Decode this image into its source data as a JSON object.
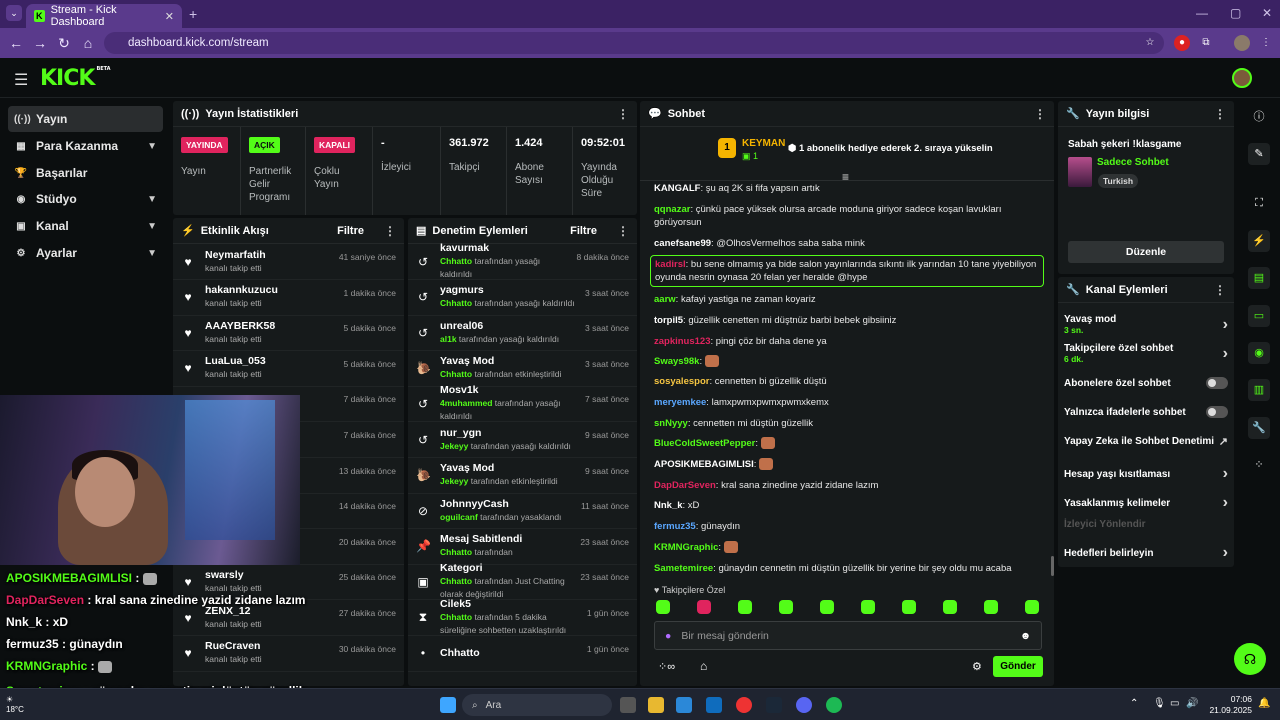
{
  "browser": {
    "tab_title": "Stream - Kick Dashboard",
    "url": "dashboard.kick.com/stream"
  },
  "kick": {
    "logo": "KICK",
    "logo_sup": "BETA"
  },
  "sidebar": {
    "items": [
      {
        "label": "Yayın",
        "icon": "broadcast-icon"
      },
      {
        "label": "Para Kazanma",
        "icon": "money-icon"
      },
      {
        "label": "Başarılar",
        "icon": "trophy-icon"
      },
      {
        "label": "Stüdyo",
        "icon": "studio-icon"
      },
      {
        "label": "Kanal",
        "icon": "channel-icon"
      },
      {
        "label": "Ayarlar",
        "icon": "gear-icon"
      }
    ]
  },
  "stats": {
    "title": "Yayın İstatistikleri",
    "cols": [
      {
        "badge": "YAYINDA",
        "label": "Yayın"
      },
      {
        "badge": "AÇIK",
        "label": "Partnerlik Gelir Programı"
      },
      {
        "badge": "KAPALI",
        "label": "Çoklu Yayın"
      },
      {
        "value": "-",
        "label": "İzleyici"
      },
      {
        "value": "361.972",
        "label": "Takipçi"
      },
      {
        "value": "1.424",
        "label": "Abone Sayısı"
      },
      {
        "value": "09:52:01",
        "label": "Yayında Olduğu Süre"
      }
    ]
  },
  "activity": {
    "title": "Etkinlik Akışı",
    "filter": "Filtre",
    "rows": [
      {
        "name": "Neymarfatih",
        "desc": "kanalı takip etti",
        "time": "41 saniye önce"
      },
      {
        "name": "hakannkuzucu",
        "desc": "kanalı takip etti",
        "time": "1 dakika önce"
      },
      {
        "name": "AAAYBERK58",
        "desc": "kanalı takip etti",
        "time": "5 dakika önce"
      },
      {
        "name": "LuaLua_053",
        "desc": "kanalı takip etti",
        "time": "5 dakika önce"
      },
      {
        "name": "",
        "desc": "",
        "time": "7 dakika önce"
      },
      {
        "name": "",
        "desc": "",
        "time": "7 dakika önce"
      },
      {
        "name": "",
        "desc": "",
        "time": "13 dakika önce"
      },
      {
        "name": "",
        "desc": "",
        "time": "14 dakika önce"
      },
      {
        "name": "",
        "desc": "",
        "time": "20 dakika önce"
      },
      {
        "name": "swarsly",
        "desc": "kanalı takip etti",
        "time": "25 dakika önce"
      },
      {
        "name": "ZENX_12",
        "desc": "kanalı takip etti",
        "time": "27 dakika önce"
      },
      {
        "name": "RueCraven",
        "desc": "kanalı takip etti",
        "time": "30 dakika önce"
      }
    ]
  },
  "moderation": {
    "title": "Denetim Eylemleri",
    "filter": "Filtre",
    "rows": [
      {
        "name": "kavurmak",
        "who": "Chhatto",
        "desc": "tarafından yasağı kaldırıldı",
        "time": "8 dakika önce",
        "icon": "undo-icon"
      },
      {
        "name": "yagmurs",
        "who": "Chhatto",
        "desc": "tarafından yasağı kaldırıldı",
        "time": "3 saat önce",
        "icon": "undo-icon"
      },
      {
        "name": "unreal06",
        "who": "al1k",
        "desc": "tarafından yasağı kaldırıldı",
        "time": "3 saat önce",
        "icon": "undo-icon"
      },
      {
        "name": "Yavaş Mod",
        "who": "Chhatto",
        "desc": "tarafından etkinleştirildi",
        "time": "3 saat önce",
        "icon": "snail-icon"
      },
      {
        "name": "Mosv1k",
        "who": "4muhammed",
        "desc": "tarafından yasağı kaldırıldı",
        "time": "7 saat önce",
        "icon": "undo-icon"
      },
      {
        "name": "nur_ygn",
        "who": "Jekeyy",
        "desc": "tarafından yasağı kaldırıldı",
        "time": "9 saat önce",
        "icon": "undo-icon"
      },
      {
        "name": "Yavaş Mod",
        "who": "Jekeyy",
        "desc": "tarafından etkinleştirildi",
        "time": "9 saat önce",
        "icon": "snail-icon"
      },
      {
        "name": "JohnnyyCash",
        "who": "oguilcanf",
        "desc": "tarafından yasaklandı",
        "time": "11 saat önce",
        "icon": "ban-icon"
      },
      {
        "name": "Mesaj Sabitlendi",
        "who": "Chhatto",
        "desc": "tarafından",
        "time": "23 saat önce",
        "icon": "pin-icon"
      },
      {
        "name": "Kategori",
        "who": "Chhatto",
        "desc": "tarafından Just Chatting olarak değiştirildi",
        "time": "23 saat önce",
        "icon": "category-icon"
      },
      {
        "name": "Cilek5",
        "who": "Chhatto",
        "desc": "tarafından 5 dakika süreliğine sohbetten uzaklaştırıldı",
        "time": "1 gün önce",
        "icon": "hourglass-icon"
      },
      {
        "name": "Chhatto",
        "who": "",
        "desc": "",
        "time": "1 gün önce",
        "icon": "user-icon"
      }
    ]
  },
  "chat": {
    "title": "Sohbet",
    "pinned_user": "KEYMAN",
    "pinned_rank": "1",
    "pinned_count": "1",
    "pinned_text": "1 abonelik hediye ederek 2. sıraya yükselin",
    "messages": [
      {
        "user": "KANGALF",
        "color": "#ffffff",
        "text": "şu aq 2K si fifa yapsın artık"
      },
      {
        "user": "qqnazar",
        "color": "#53fc18",
        "text": "çünkü pace yüksek olursa arcade moduna giriyor sadece koşan lavukları görüyorsun"
      },
      {
        "user": "canefsane99",
        "color": "#ffffff",
        "text": "@OlhosVermelhos saba saba mink"
      },
      {
        "user": "kadirsl",
        "color": "#e0245e",
        "text": "bu sene olmamış ya bide salon yayınlarında sıkıntı ilk yarından 10 tane yiyebiliyon oyunda nesrin oynasa 20 felan yer heralde @hype"
      },
      {
        "user": "aarw",
        "color": "#53fc18",
        "text": "kafayi yastiga ne zaman koyariz"
      },
      {
        "user": "torpil5",
        "color": "#ffffff",
        "text": "güzellik cenetten mi düştnüz barbi bebek gibsiiniz"
      },
      {
        "user": "zapkinus123",
        "color": "#e0245e",
        "text": "pingi çöz bir daha dene ya"
      },
      {
        "user": "Sways98k",
        "color": "#53fc18",
        "text": ""
      },
      {
        "user": "sosyalespor",
        "color": "#f5c542",
        "text": "cennetten bi güzellik düştü"
      },
      {
        "user": "meryemkee",
        "color": "#5aa7ff",
        "text": "lamxpwmxpwmxpwmxkemx"
      },
      {
        "user": "snNyyy",
        "color": "#53fc18",
        "text": "cennetten mi düştün güzellik"
      },
      {
        "user": "BlueColdSweetPepper",
        "color": "#53fc18",
        "text": ""
      },
      {
        "user": "APOSIKMEBAGIMLISI",
        "color": "#ffffff",
        "text": ""
      },
      {
        "user": "DapDarSeven",
        "color": "#e0245e",
        "text": "kral sana zinedine yazid zidane lazım"
      },
      {
        "user": "Nnk_k",
        "color": "#ffffff",
        "text": "xD"
      },
      {
        "user": "fermuz35",
        "color": "#5aa7ff",
        "text": "günaydın"
      },
      {
        "user": "KRMNGraphic",
        "color": "#53fc18",
        "text": ""
      },
      {
        "user": "Sametemiree",
        "color": "#53fc18",
        "text": "günaydın cennetin mi düştün güzellik bir yerine bir şey oldu mu acaba"
      }
    ],
    "followers_only": "Takipçilere Özel",
    "input_placeholder": "Bir mesaj gönderin",
    "send_label": "Gönder"
  },
  "stream_info": {
    "title": "Yayın bilgisi",
    "stream_title": "Sabah şekeri !klasgame",
    "category": "Sadece Sohbet",
    "language": "Turkish",
    "edit_label": "Düzenle"
  },
  "channel_actions": {
    "title": "Kanal Eylemleri",
    "items": [
      {
        "label": "Yavaş mod",
        "sub": "3 sn.",
        "type": "chevron"
      },
      {
        "label": "Takipçilere özel sohbet",
        "sub": "6 dk.",
        "type": "chevron"
      },
      {
        "label": "Abonelere özel sohbet",
        "sub": "",
        "type": "toggle"
      },
      {
        "label": "Yalnızca ifadelerle sohbet",
        "sub": "",
        "type": "toggle"
      },
      {
        "label": "Yapay Zeka ile Sohbet Denetimi",
        "sub": "",
        "type": "external"
      },
      {
        "label": "Hesap yaşı kısıtlaması",
        "sub": "",
        "type": "chevron"
      },
      {
        "label": "Yasaklanmış kelimeler",
        "sub": "",
        "type": "chevron"
      },
      {
        "label": "İzleyici Yönlendir",
        "sub": "",
        "type": "disabled"
      },
      {
        "label": "Hedefleri belirleyin",
        "sub": "",
        "type": "chevron"
      }
    ]
  },
  "overlay_chat": [
    {
      "user": "APOSIKMEBAGIMLISI",
      "color": "#53fc18",
      "text": ""
    },
    {
      "user": "DapDarSeven",
      "color": "#e0245e",
      "text": "kral sana zinedine yazid zidane lazım"
    },
    {
      "user": "Nnk_k",
      "color": "#ffffff",
      "text": "xD"
    },
    {
      "user": "fermuz35",
      "color": "#ffffff",
      "text": "günaydın"
    },
    {
      "user": "KRMNGraphic",
      "color": "#53fc18",
      "text": ""
    },
    {
      "user": "Sametemiree",
      "color": "#53fc18",
      "text": "günaydın cennetin mi düştün güzellik bir yerine bir şey oldu mu acaba"
    }
  ],
  "taskbar": {
    "search": "Ara",
    "time": "07:06",
    "date": "21.09.2025",
    "weather": "18°C"
  },
  "colors": {
    "accent": "#53fc18",
    "live": "#e0245e",
    "bg": "#0b0e0f",
    "panel": "#161a1b"
  }
}
